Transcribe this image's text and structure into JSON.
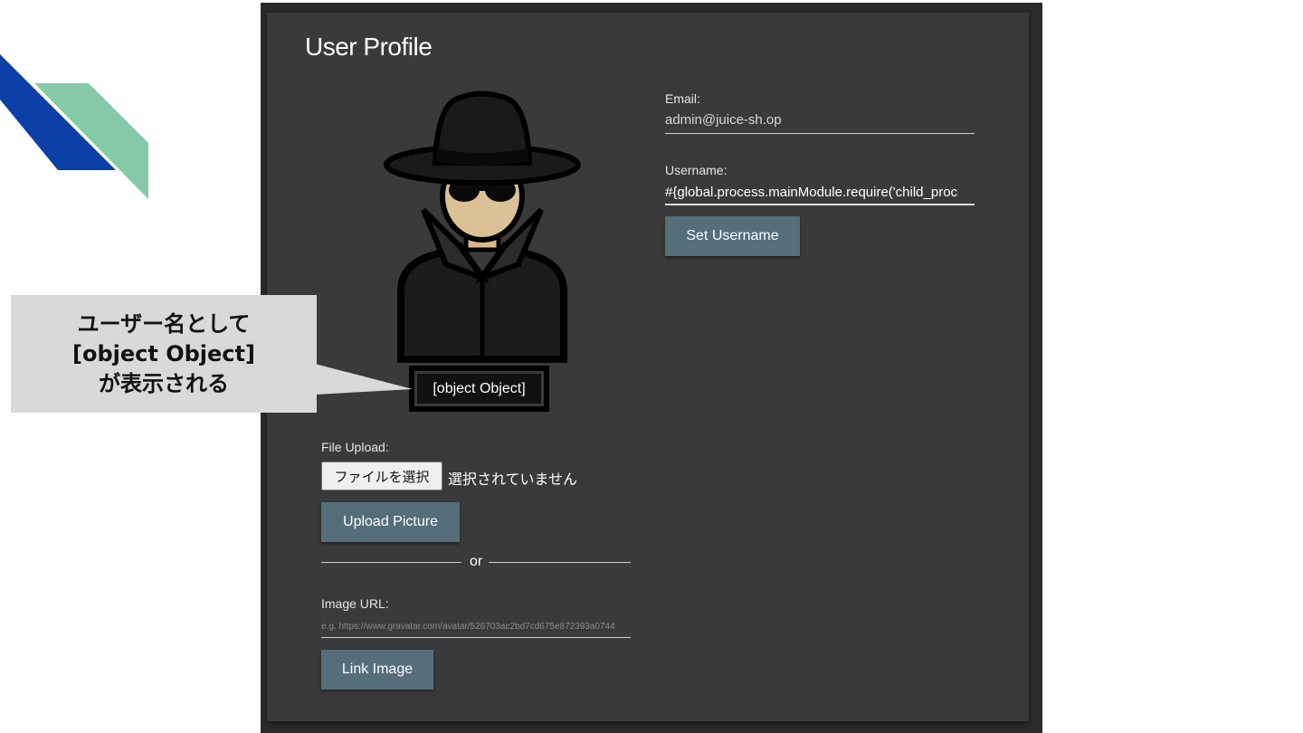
{
  "profile": {
    "title": "User Profile",
    "username_display": "[object Object]",
    "email_label": "Email:",
    "email_value": "admin@juice-sh.op",
    "username_label": "Username:",
    "username_value": "#{global.process.mainModule.require('child_proc",
    "set_username_label": "Set Username",
    "file_upload_label": "File Upload:",
    "file_choose_label": "ファイルを選択",
    "file_status": "選択されていません",
    "upload_picture_label": "Upload Picture",
    "or_text": "or",
    "image_url_label": "Image URL:",
    "image_url_placeholder": "e.g. https://www.gravatar.com/avatar/526703ac2bd7cd675e872393a0744",
    "link_image_label": "Link Image"
  },
  "callout": {
    "line1": "ユーザー名として",
    "line2": "[object Object]",
    "line3": "が表示される"
  },
  "colors": {
    "card_bg": "#3a3a3a",
    "button_bg": "#546e7a",
    "callout_bg": "#d9d9d9",
    "deco_blue": "#0a3fa6",
    "deco_green": "#86c9a6"
  },
  "icons": {
    "avatar": "hacker-avatar-icon"
  }
}
